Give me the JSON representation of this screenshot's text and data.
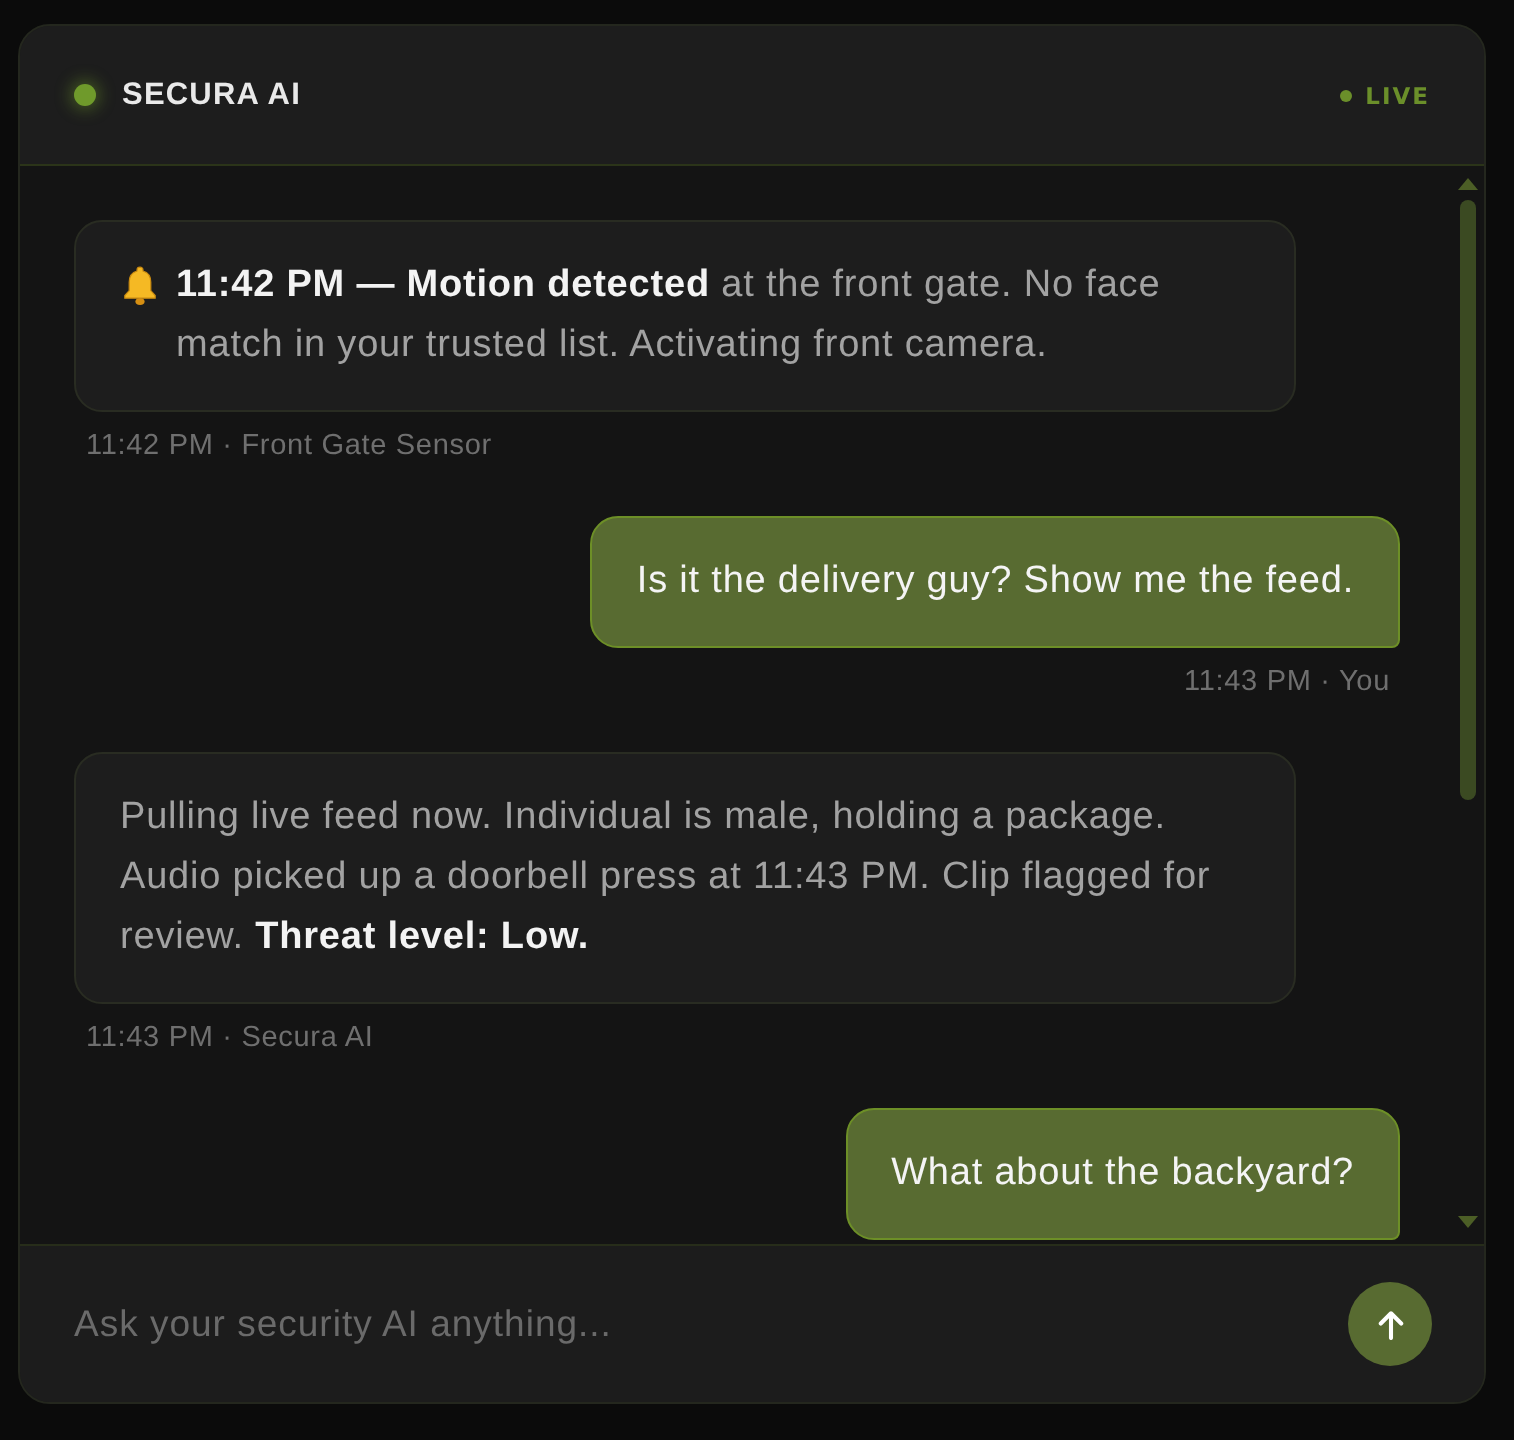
{
  "header": {
    "title": "SECURA AI",
    "online": true,
    "status": "LIVE"
  },
  "messages": [
    {
      "kind": "alert",
      "text": "**11:42 PM — Motion detected** at the front gate. No face match in your trusted list. Activating front camera.",
      "meta": "11:42 PM · Front Gate Sensor"
    },
    {
      "kind": "user",
      "text": "Is it the delivery guy? Show me the feed.",
      "meta": "11:43 PM · You"
    },
    {
      "kind": "bot",
      "text": "Pulling live feed now. Individual is male, holding a package. Audio picked up a doorbell press at 11:43 PM. Clip flagged for review. **Threat level: Low.**",
      "meta": "11:43 PM · Secura AI"
    },
    {
      "kind": "user",
      "text": "What about the backyard?"
    }
  ],
  "composer": {
    "placeholder": "Ask your security AI anything..."
  }
}
